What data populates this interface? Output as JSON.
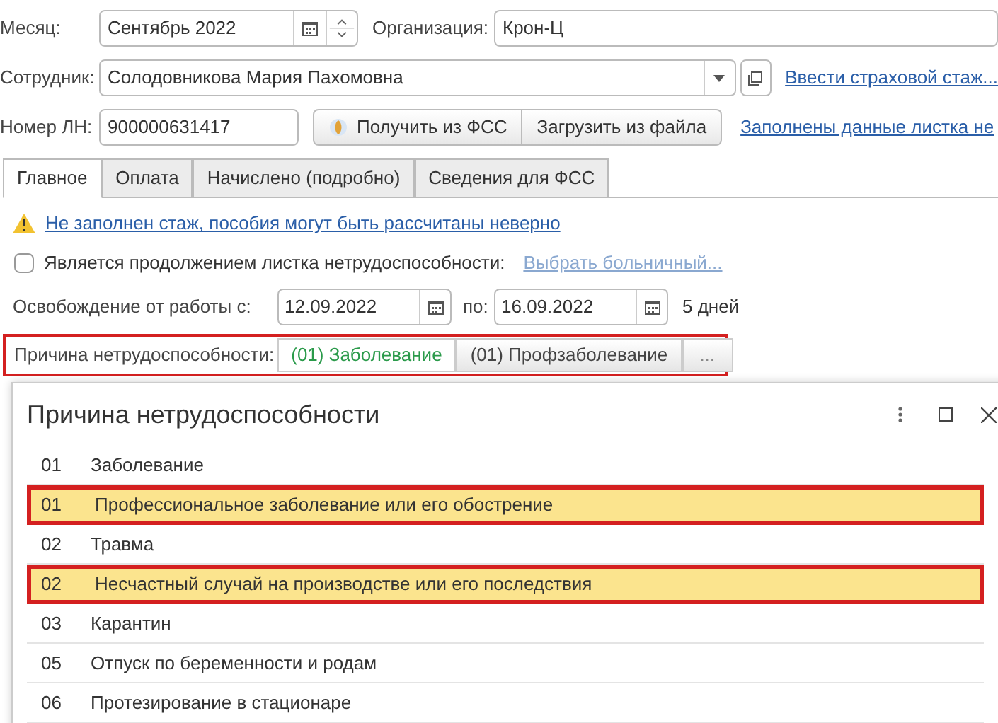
{
  "header": {
    "month": {
      "label": "Месяц:",
      "value": "Сентябрь 2022"
    },
    "organization": {
      "label": "Организация:",
      "value": "Крон-Ц"
    },
    "employee": {
      "label": "Сотрудник:",
      "value": "Солодовникова Мария Пахомовна",
      "link": "Ввести страховой стаж..."
    },
    "sick_number": {
      "label": "Номер ЛН:",
      "value": "900000631417",
      "buttons": [
        "Получить из ФСС",
        "Загрузить из файла"
      ],
      "link": "Заполнены данные листка не"
    }
  },
  "tabs": [
    {
      "label": "Главное",
      "selected": true
    },
    {
      "label": "Оплата",
      "selected": false
    },
    {
      "label": "Начислено (подробно)",
      "selected": false
    },
    {
      "label": "Сведения для ФСС",
      "selected": false
    }
  ],
  "warning": "Не заполнен стаж, пособия могут быть рассчитаны неверно",
  "continuation": {
    "label": "Является продолжением листка нетрудоспособности:",
    "checked": false,
    "link": "Выбрать больничный..."
  },
  "release": {
    "label": "Освобождение от работы с:",
    "from": "12.09.2022",
    "to_label": "по:",
    "to": "16.09.2022",
    "days": "5 дней"
  },
  "reason": {
    "label": "Причина нетрудоспособности:",
    "highlighted": true,
    "options": [
      {
        "label": "(01) Заболевание",
        "selected": true
      },
      {
        "label": "(01) Профзаболевание",
        "selected": false
      }
    ],
    "more": "..."
  },
  "dialog": {
    "title": "Причина нетрудоспособности",
    "rows": [
      {
        "code": "01",
        "name": "Заболевание",
        "highlighted": false
      },
      {
        "code": "01",
        "name": "Профессиональное заболевание или его обострение",
        "highlighted": true
      },
      {
        "code": "02",
        "name": "Травма",
        "highlighted": false
      },
      {
        "code": "02",
        "name": "Несчастный случай на производстве или его последствия",
        "highlighted": true
      },
      {
        "code": "03",
        "name": "Карантин",
        "highlighted": false
      },
      {
        "code": "05",
        "name": "Отпуск по беременности и родам",
        "highlighted": false
      },
      {
        "code": "06",
        "name": "Протезирование в стационаре",
        "highlighted": false
      }
    ]
  }
}
